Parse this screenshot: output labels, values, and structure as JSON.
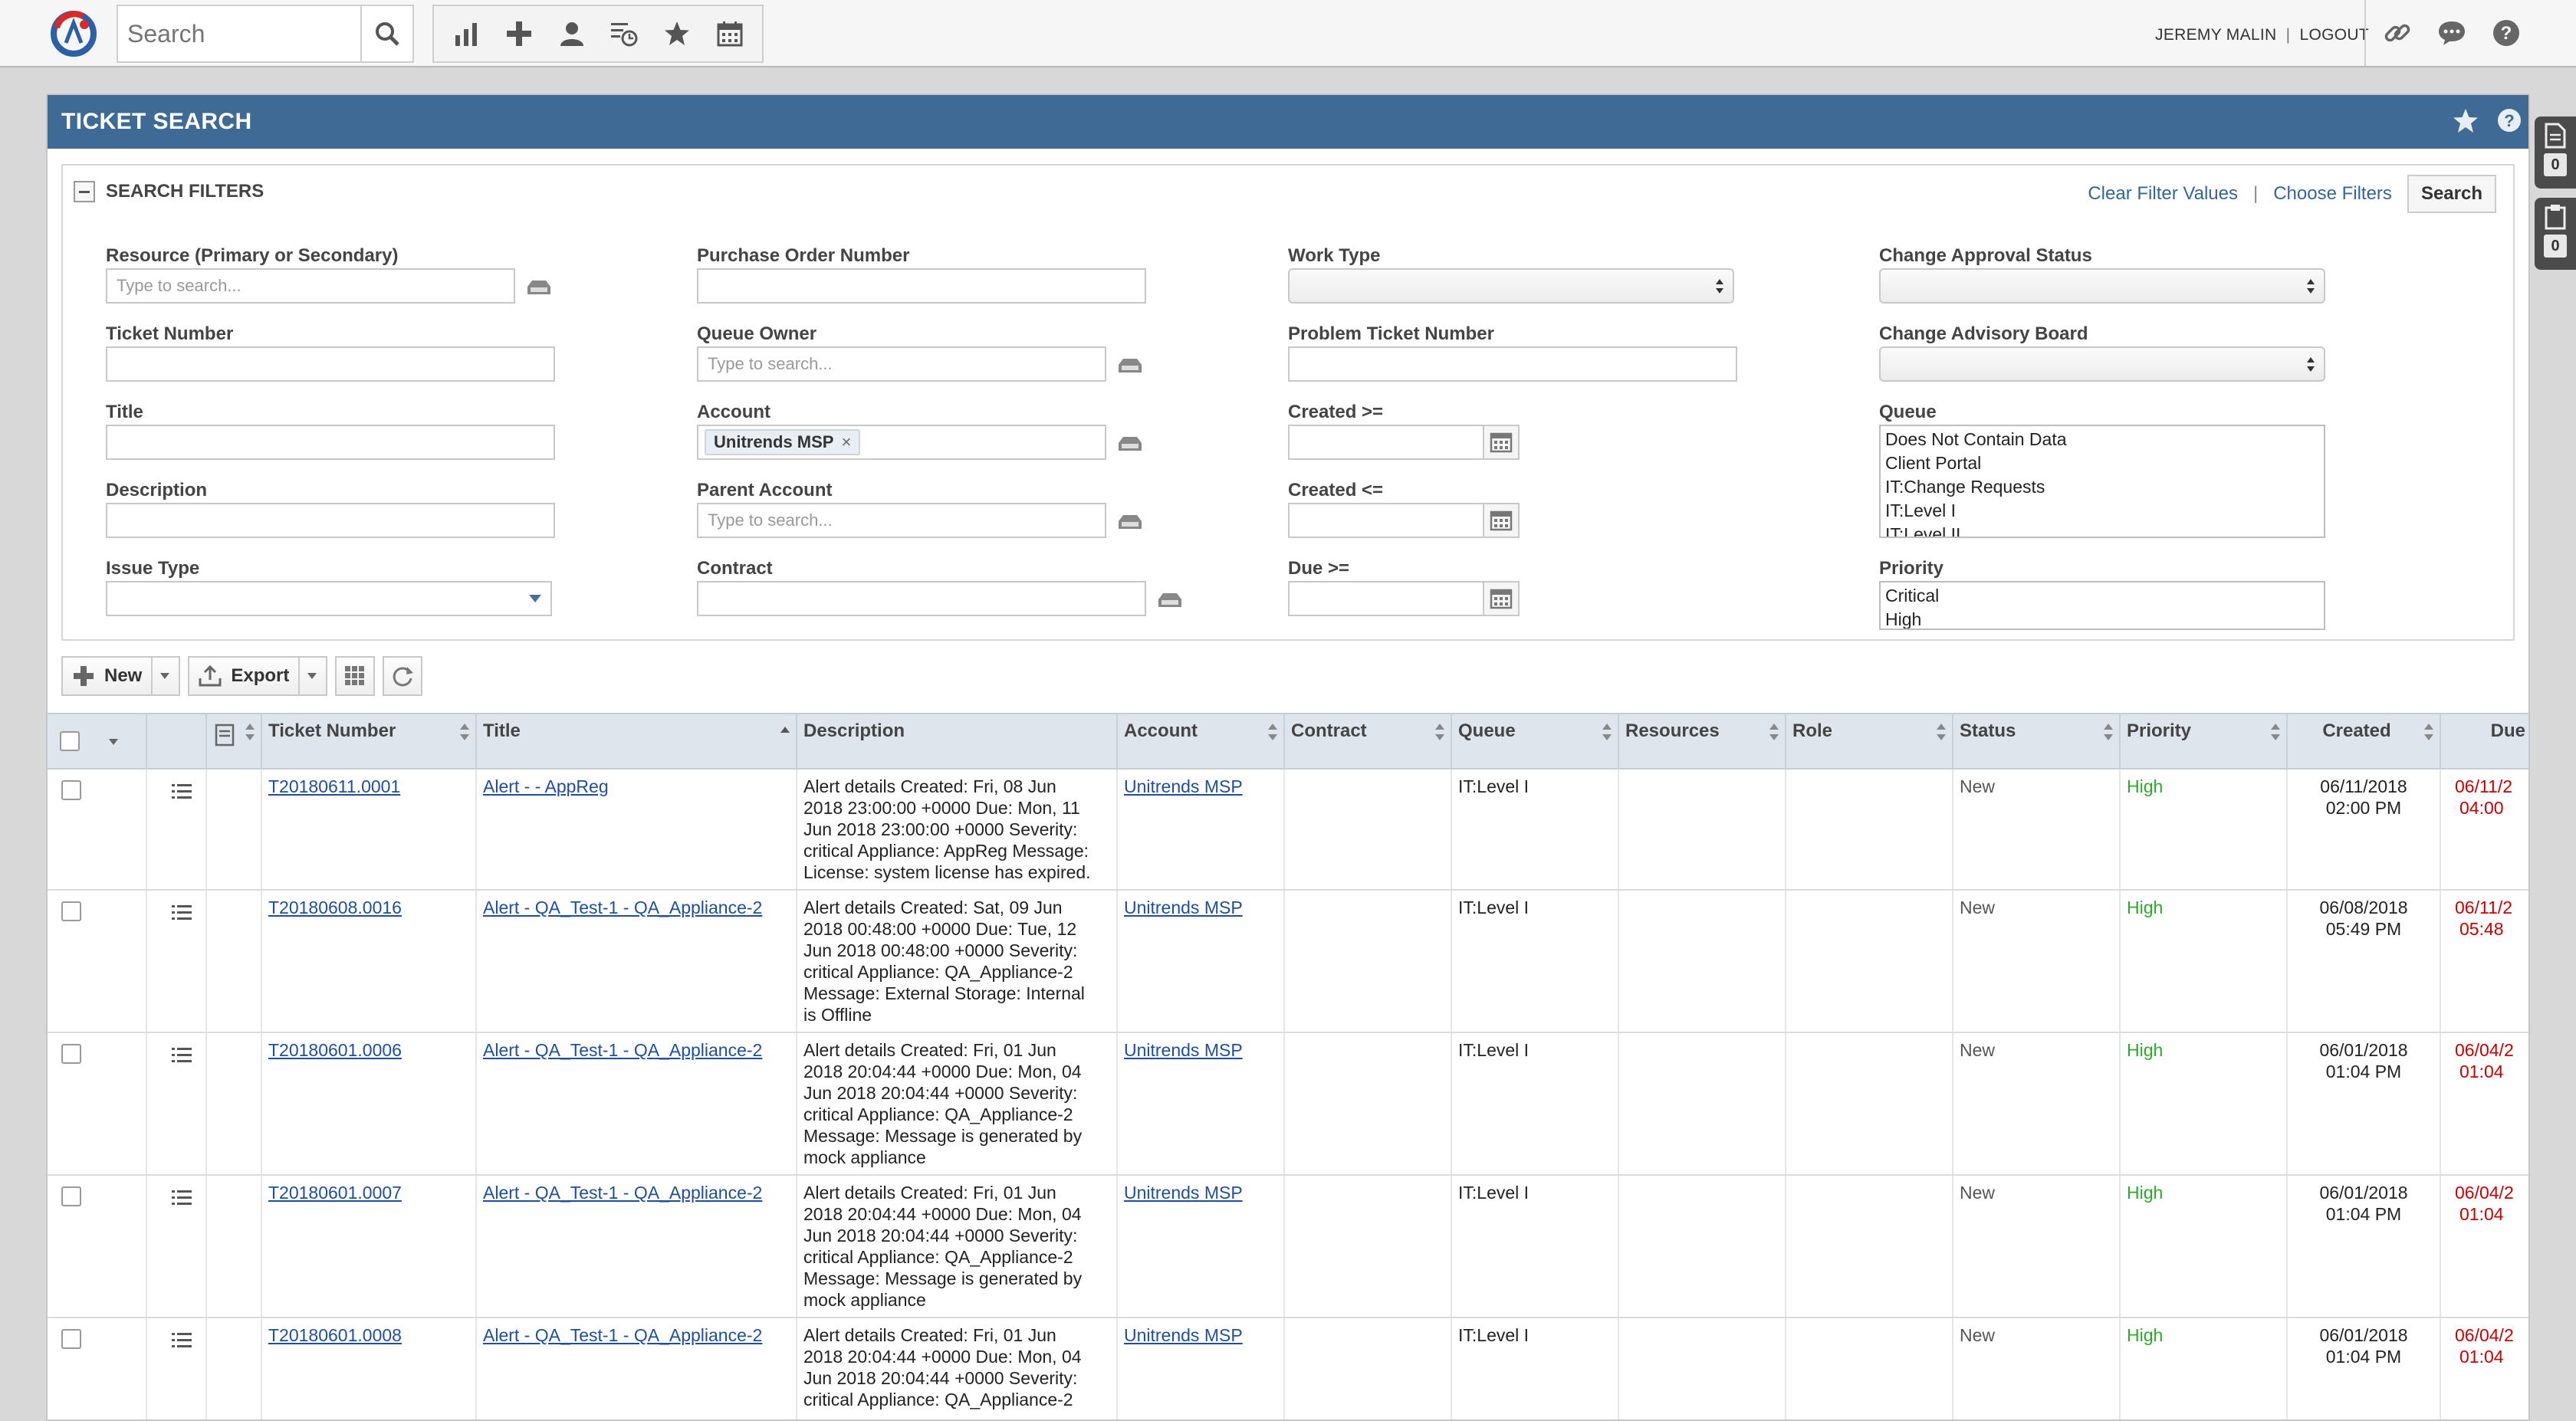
{
  "topbar": {
    "search_placeholder": "Search",
    "user_name": "JEREMY MALIN",
    "divider": "|",
    "logout": "LOGOUT"
  },
  "side_tabs": [
    {
      "icon": "document-icon",
      "count": "0"
    },
    {
      "icon": "clipboard-icon",
      "count": "0"
    }
  ],
  "panel": {
    "title": "TICKET SEARCH"
  },
  "filters": {
    "title": "SEARCH FILTERS",
    "clear_link": "Clear Filter Values",
    "sep": "|",
    "choose_link": "Choose Filters",
    "search_button": "Search",
    "resource_label": "Resource (Primary or Secondary)",
    "resource_placeholder": "Type to search...",
    "ticket_number_label": "Ticket Number",
    "title_label": "Title",
    "description_label": "Description",
    "issue_type_label": "Issue Type",
    "po_label": "Purchase Order Number",
    "queue_owner_label": "Queue Owner",
    "queue_owner_placeholder": "Type to search...",
    "account_label": "Account",
    "account_tag": "Unitrends MSP",
    "account_tag_remove": "×",
    "parent_account_label": "Parent Account",
    "parent_account_placeholder": "Type to search...",
    "contract_label": "Contract",
    "work_type_label": "Work Type",
    "problem_ticket_label": "Problem Ticket Number",
    "created_gte_label": "Created >=",
    "created_lte_label": "Created <=",
    "due_gte_label": "Due >=",
    "change_approval_label": "Change Approval Status",
    "change_board_label": "Change Advisory Board",
    "queue_label": "Queue",
    "queue_options": [
      "Does Not Contain Data",
      "Client Portal",
      "IT:Change Requests",
      "IT:Level I",
      "IT:Level II"
    ],
    "priority_label": "Priority",
    "priority_options": [
      "Critical",
      "High"
    ]
  },
  "toolbar": {
    "new_label": "New",
    "export_label": "Export"
  },
  "grid": {
    "headers": {
      "ticket_number": "Ticket Number",
      "title": "Title",
      "description": "Description",
      "account": "Account",
      "contract": "Contract",
      "queue": "Queue",
      "resources": "Resources",
      "role": "Role",
      "status": "Status",
      "priority": "Priority",
      "created": "Created",
      "due": "Due"
    },
    "rows": [
      {
        "ticket": "T20180611.0001",
        "title": "Alert - - AppReg",
        "description": [
          "Alert details Created: Fri, 08 Jun",
          "2018 23:00:00 +0000 Due: Mon, 11",
          "Jun 2018 23:00:00 +0000 Severity:",
          "critical Appliance: AppReg Message:",
          "License: system license has expired."
        ],
        "account": "Unitrends MSP",
        "queue": "IT:Level I",
        "status": "New",
        "priority": "High",
        "created": [
          "06/11/2018",
          "02:00 PM"
        ],
        "due": [
          "06/11/2",
          "04:00"
        ]
      },
      {
        "ticket": "T20180608.0016",
        "title": "Alert - QA_Test-1 - QA_Appliance-2",
        "description": [
          "Alert details Created: Sat, 09 Jun",
          "2018 00:48:00 +0000 Due: Tue, 12",
          "Jun 2018 00:48:00 +0000 Severity:",
          "critical Appliance: QA_Appliance-2",
          "Message: External Storage: Internal",
          "is Offline"
        ],
        "account": "Unitrends MSP",
        "queue": "IT:Level I",
        "status": "New",
        "priority": "High",
        "created": [
          "06/08/2018",
          "05:49 PM"
        ],
        "due": [
          "06/11/2",
          "05:48"
        ]
      },
      {
        "ticket": "T20180601.0006",
        "title": "Alert - QA_Test-1 - QA_Appliance-2",
        "description": [
          "Alert details Created: Fri, 01 Jun",
          "2018 20:04:44 +0000 Due: Mon, 04",
          "Jun 2018 20:04:44 +0000 Severity:",
          "critical Appliance: QA_Appliance-2",
          "Message: Message is generated by",
          "mock appliance"
        ],
        "account": "Unitrends MSP",
        "queue": "IT:Level I",
        "status": "New",
        "priority": "High",
        "created": [
          "06/01/2018",
          "01:04 PM"
        ],
        "due": [
          "06/04/2",
          "01:04"
        ]
      },
      {
        "ticket": "T20180601.0007",
        "title": "Alert - QA_Test-1 - QA_Appliance-2",
        "description": [
          "Alert details Created: Fri, 01 Jun",
          "2018 20:04:44 +0000 Due: Mon, 04",
          "Jun 2018 20:04:44 +0000 Severity:",
          "critical Appliance: QA_Appliance-2",
          "Message: Message is generated by",
          "mock appliance"
        ],
        "account": "Unitrends MSP",
        "queue": "IT:Level I",
        "status": "New",
        "priority": "High",
        "created": [
          "06/01/2018",
          "01:04 PM"
        ],
        "due": [
          "06/04/2",
          "01:04"
        ]
      },
      {
        "ticket": "T20180601.0008",
        "title": "Alert - QA_Test-1 - QA_Appliance-2",
        "description": [
          "Alert details Created: Fri, 01 Jun",
          "2018 20:04:44 +0000 Due: Mon, 04",
          "Jun 2018 20:04:44 +0000 Severity:",
          "critical Appliance: QA_Appliance-2"
        ],
        "account": "Unitrends MSP",
        "queue": "IT:Level I",
        "status": "New",
        "priority": "High",
        "created": [
          "06/01/2018",
          "01:04 PM"
        ],
        "due": [
          "06/04/2",
          "01:04"
        ]
      }
    ]
  }
}
